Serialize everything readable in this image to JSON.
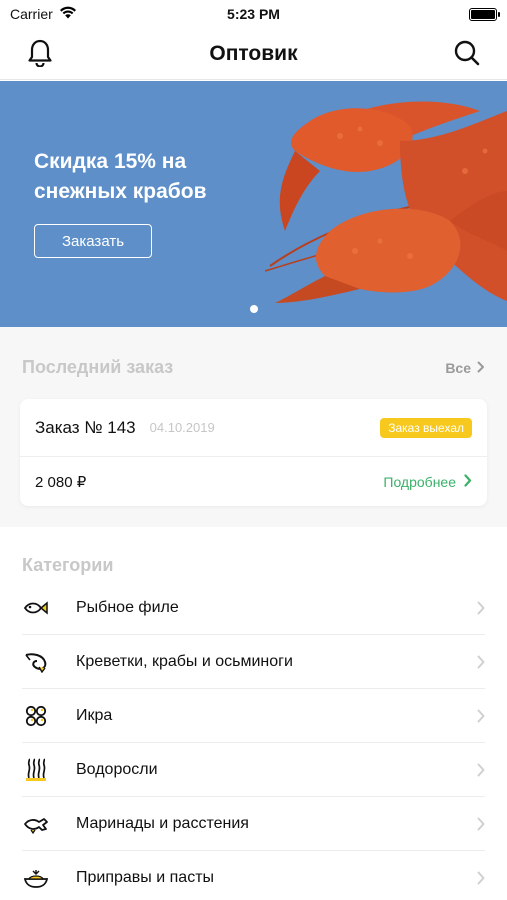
{
  "status_bar": {
    "carrier": "Carrier",
    "time": "5:23 PM"
  },
  "nav": {
    "title": "Оптовик",
    "left_icon": "bell-icon",
    "right_icon": "search-icon"
  },
  "banner": {
    "title": "Скидка 15% на снежных крабов",
    "button_label": "Заказать",
    "pages": 1,
    "current_page": 1
  },
  "last_order": {
    "section_title": "Последний заказ",
    "see_all_label": "Все",
    "order_number": "Заказ № 143",
    "date": "04.10.2019",
    "status": "Заказ выехал",
    "total": "2 080 ₽",
    "details_label": "Подробнее"
  },
  "categories": {
    "title": "Категории",
    "items": [
      {
        "label": "Рыбное филе",
        "icon": "fish-fillet-icon"
      },
      {
        "label": "Креветки, крабы и осьминоги",
        "icon": "shrimp-icon"
      },
      {
        "label": "Икра",
        "icon": "caviar-icon"
      },
      {
        "label": "Водоросли",
        "icon": "seaweed-icon"
      },
      {
        "label": "Маринады и расстения",
        "icon": "marinade-icon"
      },
      {
        "label": "Приправы и пасты",
        "icon": "seasoning-icon"
      }
    ]
  },
  "colors": {
    "banner": "#5e8fc9",
    "accent_yellow": "#f7c81e",
    "accent_green": "#3ab26a"
  }
}
